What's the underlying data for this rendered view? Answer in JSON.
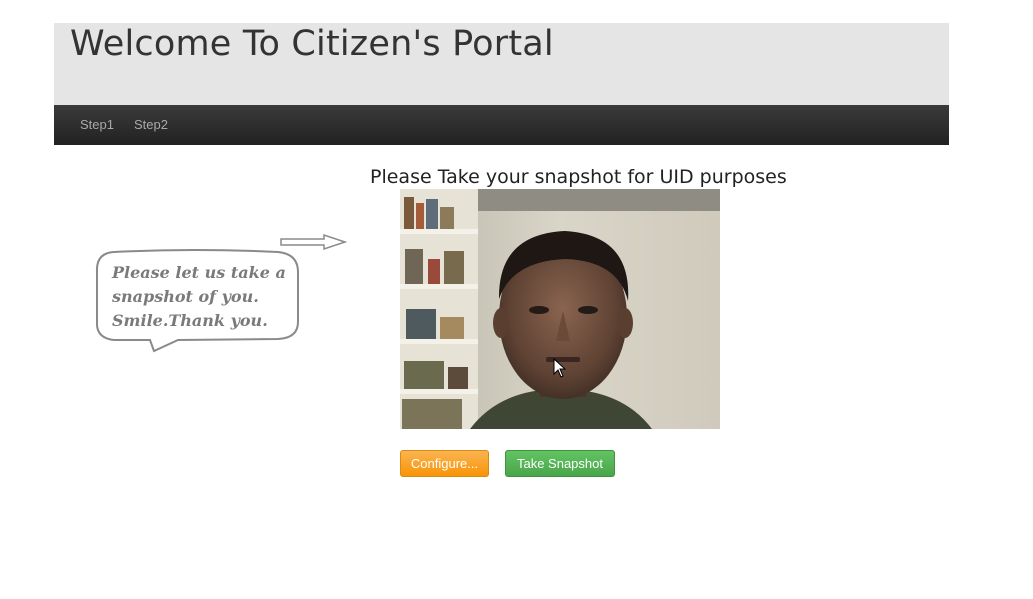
{
  "header": {
    "title": "Welcome To Citizen's Portal"
  },
  "nav": {
    "items": [
      {
        "label": "Step1"
      },
      {
        "label": "Step2"
      }
    ]
  },
  "main": {
    "instruction": "Please Take your snapshot for UID purposes",
    "speech_bubble": {
      "line1": "Please let us take a",
      "line2": "snapshot of you.",
      "line3": "Smile.Thank you."
    },
    "buttons": {
      "configure_label": "Configure...",
      "snapshot_label": "Take Snapshot"
    }
  },
  "colors": {
    "hero_bg": "#e5e5e5",
    "navbar_bg": "#222222",
    "configure_button": "#f89406",
    "snapshot_button": "#5bb75b"
  },
  "icons": {
    "arrow": "right-arrow-icon",
    "cursor": "mouse-pointer-icon"
  }
}
